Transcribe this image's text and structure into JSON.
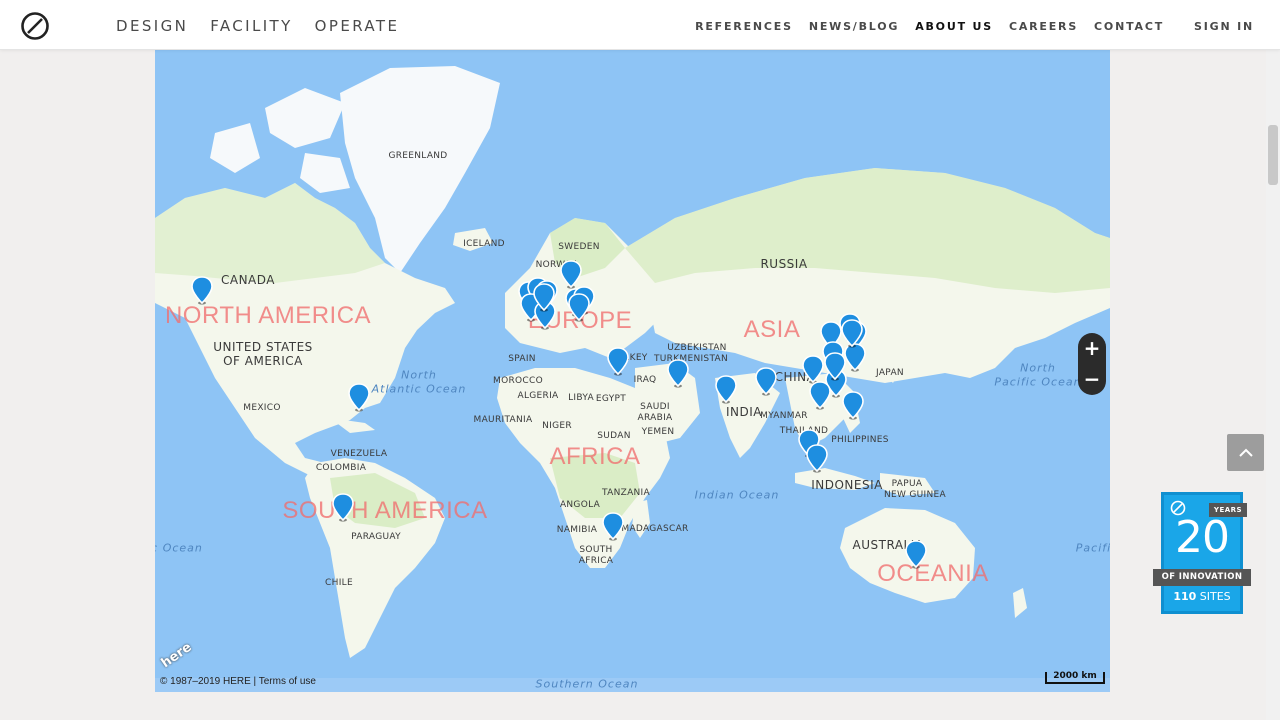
{
  "header": {
    "nav_left": [
      "DESIGN",
      "FACILITY",
      "OPERATE"
    ],
    "nav_right": [
      "REFERENCES",
      "NEWS/BLOG",
      "ABOUT US",
      "CAREERS",
      "CONTACT"
    ],
    "active": "ABOUT US",
    "sign_in": "SIGN IN",
    "logo_icon": "circle-slash-logo"
  },
  "map": {
    "continents": [
      {
        "name": "NORTH AMERICA"
      },
      {
        "name": "SOUTH AMERICA"
      },
      {
        "name": "EUROPE"
      },
      {
        "name": "AFRICA"
      },
      {
        "name": "ASIA"
      },
      {
        "name": "OCEANIA"
      }
    ],
    "countries": [
      "GREENLAND",
      "CANADA",
      "UNITED STATES",
      "OF AMERICA",
      "MEXICO",
      "ICELAND",
      "SWEDEN",
      "NORWAY",
      "RUSSIA",
      "UZBEKISTAN",
      "TURKMENISTAN",
      "TURKEY",
      "SPAIN",
      "MOROCCO",
      "ALGERIA",
      "LIBYA",
      "EGYPT",
      "IRAQ",
      "SAUDI",
      "ARABIA",
      "YEMEN",
      "MAURITANIA",
      "NIGER",
      "SUDAN",
      "TANZANIA",
      "ANGOLA",
      "NAMIBIA",
      "MADAGASCAR",
      "SOUTH",
      "AFRICA",
      "VENEZUELA",
      "COLOMBIA",
      "PARAGUAY",
      "CHILE",
      "INDIA",
      "CHINA",
      "MYANMAR",
      "THAILAND",
      "PHILIPPINES",
      "JAPAN",
      "INDONESIA",
      "PAPUA",
      "NEW GUINEA",
      "AUSTRALIA"
    ],
    "oceans": [
      "North",
      "Atlantic Ocean",
      "North",
      "Pacific Ocean",
      "Indian Ocean",
      "Southern Ocean",
      "ic Ocean",
      "Pacific"
    ],
    "marker_count": 32,
    "zoom_in": "+",
    "zoom_out": "−",
    "attribution": "© 1987–2019 HERE | Terms of use",
    "here_logo": "here",
    "scale": "2000 km",
    "colors": {
      "water": "#8ec4f5",
      "land": "#f5f8ee",
      "green": "#cfe8b6",
      "marker": "#1e8ee0",
      "continent_label": "#f06e6e"
    }
  },
  "badge": {
    "years_label": "YEARS",
    "number": "20",
    "ribbon": "OF INNOVATION",
    "sites_count": "110",
    "sites_label": "SITES"
  },
  "scroll_top_icon": "chevron-up-icon"
}
